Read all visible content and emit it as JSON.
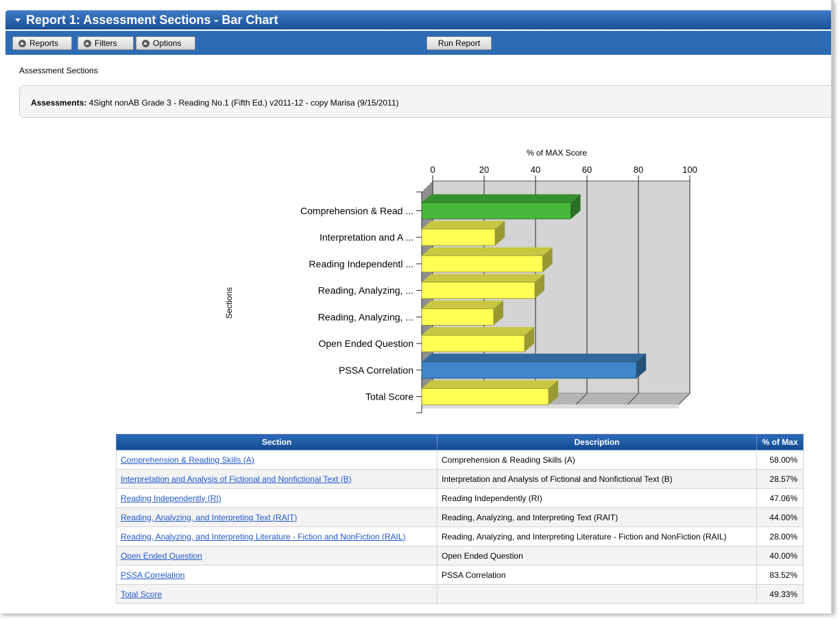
{
  "window": {
    "title": "Report 1: Assessment Sections - Bar Chart"
  },
  "toolbar": {
    "reports_label": "Reports",
    "filters_label": "Filters",
    "options_label": "Options",
    "run_label": "Run Report"
  },
  "page": {
    "heading": "Assessment Sections",
    "assessments_label": "Assessments:",
    "assessments_value": "4Sight nonAB Grade 3 - Reading No.1 (Fifth Ed.) v2011-12 - copy Marisa (9/15/2011)"
  },
  "colors": {
    "accent": "#2e6bb5",
    "green": "#47b83c",
    "yellow": "#ffff55",
    "blue": "#3f87c9",
    "link": "#1f56c9"
  },
  "chart_data": {
    "type": "bar",
    "orientation": "horizontal",
    "title": "% of MAX Score",
    "xlabel": "% of MAX Score",
    "ylabel": "Sections",
    "xlim": [
      0,
      100
    ],
    "ticks": [
      "0",
      "20",
      "40",
      "60",
      "80",
      "100"
    ],
    "grid": true,
    "legend": "none",
    "categories": [
      "Comprehension & Read ...",
      "Interpretation and A ...",
      "Reading Independentl ...",
      "Reading, Analyzing, ...",
      "Reading, Analyzing, ...",
      "Open Ended Question",
      "PSSA Correlation",
      "Total Score"
    ],
    "values": [
      58.0,
      28.57,
      47.06,
      44.0,
      28.0,
      40.0,
      83.52,
      49.33
    ],
    "bar_colors": [
      "#47b83c",
      "#ffff55",
      "#ffff55",
      "#ffff55",
      "#ffff55",
      "#ffff55",
      "#3f87c9",
      "#ffff55"
    ]
  },
  "table": {
    "columns": [
      "Section",
      "Description",
      "% of Max"
    ],
    "rows": [
      [
        "Comprehension & Reading Skills (A)",
        "Comprehension & Reading Skills (A)",
        "58.00%"
      ],
      [
        "Interpretation and Analysis of Fictional and Nonfictional Text (B)",
        "Interpretation and Analysis of Fictional and Nonfictional Text (B)",
        "28.57%"
      ],
      [
        "Reading Independently (RI)",
        "Reading Independently (RI)",
        "47.06%"
      ],
      [
        "Reading, Analyzing, and Interpreting Text (RAIT)",
        "Reading, Analyzing, and Interpreting Text (RAIT)",
        "44.00%"
      ],
      [
        "Reading, Analyzing, and Interpreting Literature - Fiction and NonFiction (RAIL)",
        "Reading, Analyzing, and Interpreting Literature - Fiction and NonFiction (RAIL)",
        "28.00%"
      ],
      [
        "Open Ended Question",
        "Open Ended Question",
        "40.00%"
      ],
      [
        "PSSA Correlation",
        "PSSA Correlation",
        "83.52%"
      ],
      [
        "Total Score",
        "",
        "49.33%"
      ]
    ]
  }
}
